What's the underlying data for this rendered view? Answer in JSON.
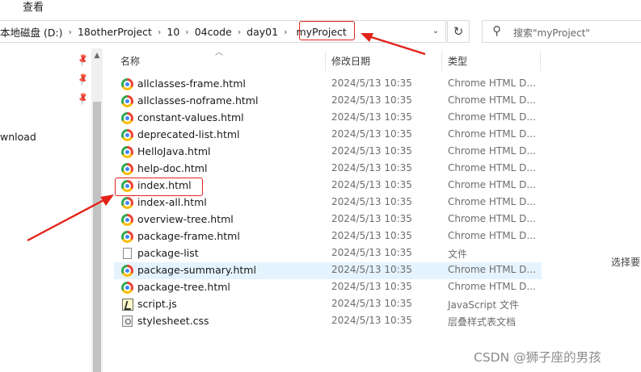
{
  "menu": {
    "view_label": "查看"
  },
  "address": {
    "crumbs": [
      "本地磁盘 (D:)",
      "18otherProject",
      "10",
      "04code",
      "day01"
    ],
    "current": "myProject",
    "separator": "›"
  },
  "search": {
    "placeholder": "搜索\"myProject\""
  },
  "nav": {
    "download_label": "wnload"
  },
  "columns": {
    "name": "名称",
    "date": "修改日期",
    "type": "类型"
  },
  "files": [
    {
      "name": "allclasses-frame.html",
      "date": "2024/5/13 10:35",
      "type": "Chrome HTML D...",
      "icon": "chrome-icon"
    },
    {
      "name": "allclasses-noframe.html",
      "date": "2024/5/13 10:35",
      "type": "Chrome HTML D...",
      "icon": "chrome-icon"
    },
    {
      "name": "constant-values.html",
      "date": "2024/5/13 10:35",
      "type": "Chrome HTML D...",
      "icon": "chrome-icon"
    },
    {
      "name": "deprecated-list.html",
      "date": "2024/5/13 10:35",
      "type": "Chrome HTML D...",
      "icon": "chrome-icon"
    },
    {
      "name": "HelloJava.html",
      "date": "2024/5/13 10:35",
      "type": "Chrome HTML D...",
      "icon": "chrome-icon"
    },
    {
      "name": "help-doc.html",
      "date": "2024/5/13 10:35",
      "type": "Chrome HTML D...",
      "icon": "chrome-icon"
    },
    {
      "name": "index.html",
      "date": "2024/5/13 10:35",
      "type": "Chrome HTML D...",
      "icon": "chrome-icon"
    },
    {
      "name": "index-all.html",
      "date": "2024/5/13 10:35",
      "type": "Chrome HTML D...",
      "icon": "chrome-icon"
    },
    {
      "name": "overview-tree.html",
      "date": "2024/5/13 10:35",
      "type": "Chrome HTML D...",
      "icon": "chrome-icon"
    },
    {
      "name": "package-frame.html",
      "date": "2024/5/13 10:35",
      "type": "Chrome HTML D...",
      "icon": "chrome-icon"
    },
    {
      "name": "package-list",
      "date": "2024/5/13 10:35",
      "type": "文件",
      "icon": "file-icon"
    },
    {
      "name": "package-summary.html",
      "date": "2024/5/13 10:35",
      "type": "Chrome HTML D...",
      "icon": "chrome-icon",
      "hover": true
    },
    {
      "name": "package-tree.html",
      "date": "2024/5/13 10:35",
      "type": "Chrome HTML D...",
      "icon": "chrome-icon"
    },
    {
      "name": "script.js",
      "date": "2024/5/13 10:35",
      "type": "JavaScript 文件",
      "icon": "javascript-file-icon"
    },
    {
      "name": "stylesheet.css",
      "date": "2024/5/13 10:35",
      "type": "层叠样式表文档",
      "icon": "css-file-icon"
    }
  ],
  "right_hint": "选择要",
  "watermark": "CSDN @狮子座的男孩",
  "colors": {
    "annotation_red": "#e2231a",
    "hover_row": "#e5f3ff"
  }
}
